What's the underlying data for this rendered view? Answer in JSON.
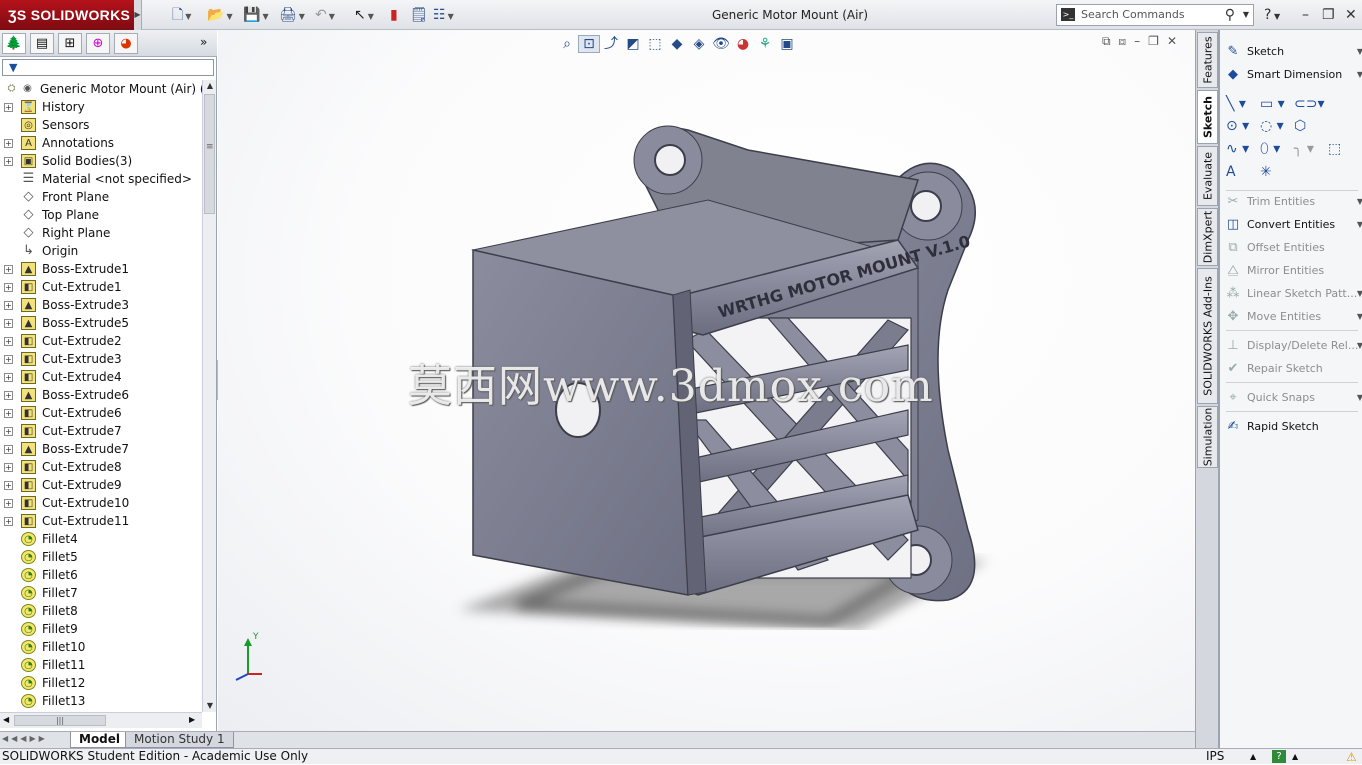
{
  "app": {
    "logo": "SOLIDWORKS",
    "document_title": "Generic Motor Mount (Air)"
  },
  "search": {
    "placeholder": "Search Commands"
  },
  "toolbar": {
    "icons": [
      "new-icon",
      "open-icon",
      "save-icon",
      "print-icon",
      "undo-icon",
      "select-icon",
      "rebuild-icon",
      "file-properties-icon",
      "options-icon"
    ]
  },
  "feature_tree": {
    "root": "Generic Motor Mount (Air)  (De",
    "items": [
      {
        "label": "History",
        "expandable": true,
        "icon": "history-icon"
      },
      {
        "label": "Sensors",
        "expandable": false,
        "icon": "sensor-icon"
      },
      {
        "label": "Annotations",
        "expandable": true,
        "icon": "annotation-icon"
      },
      {
        "label": "Solid Bodies(3)",
        "expandable": true,
        "icon": "solid-bodies-icon"
      },
      {
        "label": "Material <not specified>",
        "expandable": false,
        "icon": "material-icon"
      },
      {
        "label": "Front Plane",
        "expandable": false,
        "icon": "plane-icon"
      },
      {
        "label": "Top Plane",
        "expandable": false,
        "icon": "plane-icon"
      },
      {
        "label": "Right Plane",
        "expandable": false,
        "icon": "plane-icon"
      },
      {
        "label": "Origin",
        "expandable": false,
        "icon": "origin-icon"
      },
      {
        "label": "Boss-Extrude1",
        "expandable": true,
        "icon": "boss-extrude-icon"
      },
      {
        "label": "Cut-Extrude1",
        "expandable": true,
        "icon": "cut-extrude-icon"
      },
      {
        "label": "Boss-Extrude3",
        "expandable": true,
        "icon": "boss-extrude-icon"
      },
      {
        "label": "Boss-Extrude5",
        "expandable": true,
        "icon": "boss-extrude-icon"
      },
      {
        "label": "Cut-Extrude2",
        "expandable": true,
        "icon": "cut-extrude-icon"
      },
      {
        "label": "Cut-Extrude3",
        "expandable": true,
        "icon": "cut-extrude-icon"
      },
      {
        "label": "Cut-Extrude4",
        "expandable": true,
        "icon": "cut-extrude-icon"
      },
      {
        "label": "Boss-Extrude6",
        "expandable": true,
        "icon": "boss-extrude-icon"
      },
      {
        "label": "Cut-Extrude6",
        "expandable": true,
        "icon": "cut-extrude-icon"
      },
      {
        "label": "Cut-Extrude7",
        "expandable": true,
        "icon": "cut-extrude-icon"
      },
      {
        "label": "Boss-Extrude7",
        "expandable": true,
        "icon": "boss-extrude-icon"
      },
      {
        "label": "Cut-Extrude8",
        "expandable": true,
        "icon": "cut-extrude-icon"
      },
      {
        "label": "Cut-Extrude9",
        "expandable": true,
        "icon": "cut-extrude-icon"
      },
      {
        "label": "Cut-Extrude10",
        "expandable": true,
        "icon": "cut-extrude-icon"
      },
      {
        "label": "Cut-Extrude11",
        "expandable": true,
        "icon": "cut-extrude-icon"
      },
      {
        "label": "Fillet4",
        "expandable": false,
        "icon": "fillet-icon"
      },
      {
        "label": "Fillet5",
        "expandable": false,
        "icon": "fillet-icon"
      },
      {
        "label": "Fillet6",
        "expandable": false,
        "icon": "fillet-icon"
      },
      {
        "label": "Fillet7",
        "expandable": false,
        "icon": "fillet-icon"
      },
      {
        "label": "Fillet8",
        "expandable": false,
        "icon": "fillet-icon"
      },
      {
        "label": "Fillet9",
        "expandable": false,
        "icon": "fillet-icon"
      },
      {
        "label": "Fillet10",
        "expandable": false,
        "icon": "fillet-icon"
      },
      {
        "label": "Fillet11",
        "expandable": false,
        "icon": "fillet-icon"
      },
      {
        "label": "Fillet12",
        "expandable": false,
        "icon": "fillet-icon"
      },
      {
        "label": "Fillet13",
        "expandable": false,
        "icon": "fillet-icon"
      }
    ]
  },
  "bottom_tabs": {
    "model": "Model",
    "motion": "Motion Study 1"
  },
  "status_bar": {
    "text": "SOLIDWORKS Student Edition - Academic Use Only",
    "units": "IPS"
  },
  "viewport": {
    "model_label": "WRTHG MOTOR MOUNT V.1.0",
    "watermark": "莫西网www.3dmox.com",
    "triad_y": "Y"
  },
  "vertical_tabs": [
    "Features",
    "Sketch",
    "Evaluate",
    "DimXpert",
    "SOLIDWORKS Add-Ins",
    "Simulation"
  ],
  "command_manager": {
    "sketch": "Sketch",
    "smart_dimension": "Smart Dimension",
    "trim_entities": "Trim Entities",
    "convert_entities": "Convert Entities",
    "offset_entities": "Offset Entities",
    "mirror_entities": "Mirror Entities",
    "linear_sketch_pattern": "Linear Sketch Patt...",
    "move_entities": "Move Entities",
    "display_delete_relations": "Display/Delete Rel...",
    "repair_sketch": "Repair Sketch",
    "quick_snaps": "Quick Snaps",
    "rapid_sketch": "Rapid Sketch"
  },
  "colors": {
    "brand": "#b5121b",
    "model_grey": "#7d7f91",
    "accent": "#1d4c9c"
  }
}
